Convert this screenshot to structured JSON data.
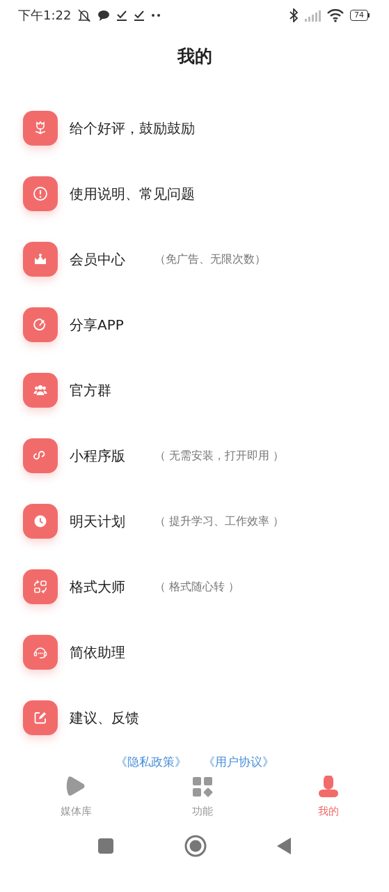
{
  "status_bar": {
    "time": "下午1:22",
    "battery": "74"
  },
  "title": "我的",
  "menu_items": [
    {
      "label": "给个好评，鼓励鼓励"
    },
    {
      "label": "使用说明、常见问题"
    },
    {
      "label": "会员中心",
      "note": "（免广告、无限次数）"
    },
    {
      "label": "分享APP"
    },
    {
      "label": "官方群"
    },
    {
      "label": "小程序版",
      "note": "（ 无需安装，打开即用 ）"
    },
    {
      "label": "明天计划",
      "note": "（ 提升学习、工作效率 ）"
    },
    {
      "label": "格式大师",
      "note": "（ 格式随心转 ）"
    },
    {
      "label": "简依助理"
    },
    {
      "label": "建议、反馈"
    }
  ],
  "links": [
    "《隐私政策》",
    "《用户协议》"
  ],
  "tabs": [
    {
      "label": "媒体库",
      "selected": false
    },
    {
      "label": "功能",
      "selected": false
    },
    {
      "label": "我的",
      "selected": true
    }
  ]
}
